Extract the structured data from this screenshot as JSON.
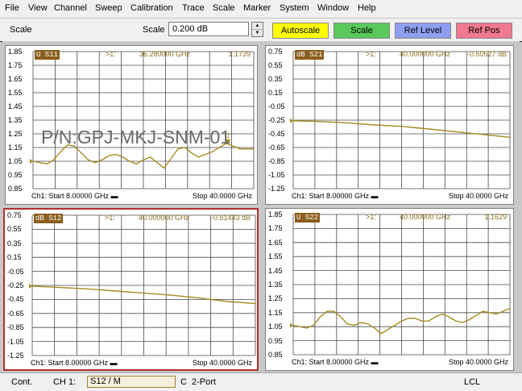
{
  "menu": [
    "File",
    "View",
    "Channel",
    "Sweep",
    "Calibration",
    "Trace",
    "Scale",
    "Marker",
    "System",
    "Window",
    "Help"
  ],
  "toolbar": {
    "title": "Scale",
    "scale_label": "Scale",
    "scale_value": "0.200 dB",
    "buttons": {
      "autoscale": "Autoscale",
      "scale": "Scale",
      "ref_level": "Ref Level",
      "ref_pos": "Ref Pos"
    },
    "colors": {
      "autoscale": "#ffff00",
      "scale": "#5ac85a",
      "ref_level": "#8f9ff0",
      "ref_pos": "#f07890"
    }
  },
  "watermark": "P/N:GPJ-MKJ-SNM-01",
  "trace_color": "#a68a1e",
  "panels": [
    {
      "id": "s11",
      "header": {
        "tag": "U S11",
        "marker": ">1:",
        "freq": "36.280000 GHz",
        "value": "1.1739"
      },
      "y_labels": [
        "1.85",
        "1.75",
        "1.65",
        "1.55",
        "1.45",
        "1.35",
        "1.25",
        "1.15",
        "1.05",
        "0.95",
        "0.85"
      ],
      "y_range": [
        0.85,
        1.85
      ],
      "footer": {
        "start": "Ch1: Start  8.00000 GHz",
        "stop": "Stop  40.0000 GHz"
      },
      "active": false,
      "marker_point": {
        "freq_ghz": 36.28,
        "value": 1.1739,
        "label": "1"
      },
      "trace": [
        [
          8,
          1.05
        ],
        [
          9,
          1.04
        ],
        [
          10,
          1.03
        ],
        [
          11,
          1.06
        ],
        [
          12,
          1.12
        ],
        [
          13,
          1.17
        ],
        [
          14,
          1.16
        ],
        [
          15,
          1.11
        ],
        [
          16,
          1.06
        ],
        [
          17,
          1.04
        ],
        [
          18,
          1.06
        ],
        [
          19,
          1.09
        ],
        [
          20,
          1.1
        ],
        [
          21,
          1.08
        ],
        [
          22,
          1.05
        ],
        [
          23,
          1.03
        ],
        [
          24,
          1.06
        ],
        [
          25,
          1.08
        ],
        [
          26,
          1.04
        ],
        [
          27,
          1.0
        ],
        [
          28,
          1.07
        ],
        [
          29,
          1.14
        ],
        [
          30,
          1.15
        ],
        [
          31,
          1.11
        ],
        [
          32,
          1.08
        ],
        [
          33,
          1.1
        ],
        [
          34,
          1.12
        ],
        [
          35,
          1.15
        ],
        [
          36,
          1.18
        ],
        [
          37,
          1.16
        ],
        [
          38,
          1.14
        ],
        [
          39,
          1.14
        ],
        [
          40,
          1.14
        ]
      ]
    },
    {
      "id": "s21",
      "header": {
        "tag": "dB S21",
        "marker": ">1:",
        "freq": "40.000000 GHz",
        "value": "-0.50527 dB"
      },
      "y_labels": [
        "0.75",
        "0.55",
        "0.35",
        "0.15",
        "-0.05",
        "-0.25",
        "-0.45",
        "-0.65",
        "-0.85",
        "-1.05",
        "-1.25"
      ],
      "y_range": [
        -1.25,
        0.75
      ],
      "footer": {
        "start": "Ch1: Start  8.00000 GHz",
        "stop": "Stop  40.0000 GHz"
      },
      "active": false,
      "trace": [
        [
          8,
          -0.26
        ],
        [
          12,
          -0.27
        ],
        [
          16,
          -0.29
        ],
        [
          20,
          -0.32
        ],
        [
          24,
          -0.34
        ],
        [
          28,
          -0.38
        ],
        [
          32,
          -0.42
        ],
        [
          36,
          -0.46
        ],
        [
          40,
          -0.5
        ]
      ]
    },
    {
      "id": "s12",
      "header": {
        "tag": "dB S12",
        "marker": ">1:",
        "freq": "40.000000 GHz",
        "value": "-0.51443 dB"
      },
      "y_labels": [
        "0.75",
        "0.55",
        "0.35",
        "0.15",
        "-0.05",
        "-0.25",
        "-0.45",
        "-0.65",
        "-0.85",
        "-1.05",
        "-1.25"
      ],
      "y_range": [
        -1.25,
        0.75
      ],
      "footer": {
        "start": "Ch1: Start  8.00000 GHz",
        "stop": "Stop  40.0000 GHz"
      },
      "active": true,
      "trace": [
        [
          8,
          -0.26
        ],
        [
          12,
          -0.28
        ],
        [
          16,
          -0.3
        ],
        [
          20,
          -0.33
        ],
        [
          24,
          -0.36
        ],
        [
          28,
          -0.39
        ],
        [
          32,
          -0.43
        ],
        [
          36,
          -0.48
        ],
        [
          40,
          -0.51
        ]
      ]
    },
    {
      "id": "s22",
      "header": {
        "tag": "U S22",
        "marker": ">1:",
        "freq": "40.000000 GHz",
        "value": "1.1629"
      },
      "y_labels": [
        "1.85",
        "1.75",
        "1.65",
        "1.55",
        "1.45",
        "1.35",
        "1.25",
        "1.15",
        "1.05",
        "0.95",
        "0.85"
      ],
      "y_range": [
        0.85,
        1.85
      ],
      "footer": {
        "start": "Ch1: Start  8.00000 GHz",
        "stop": "Stop  40.0000 GHz"
      },
      "active": false,
      "trace": [
        [
          8,
          1.06
        ],
        [
          9,
          1.05
        ],
        [
          10,
          1.04
        ],
        [
          11,
          1.06
        ],
        [
          12,
          1.12
        ],
        [
          13,
          1.16
        ],
        [
          14,
          1.16
        ],
        [
          15,
          1.12
        ],
        [
          16,
          1.07
        ],
        [
          17,
          1.06
        ],
        [
          18,
          1.08
        ],
        [
          19,
          1.07
        ],
        [
          20,
          1.04
        ],
        [
          21,
          1.0
        ],
        [
          22,
          1.03
        ],
        [
          23,
          1.06
        ],
        [
          24,
          1.09
        ],
        [
          25,
          1.11
        ],
        [
          26,
          1.11
        ],
        [
          27,
          1.09
        ],
        [
          28,
          1.09
        ],
        [
          29,
          1.12
        ],
        [
          30,
          1.14
        ],
        [
          31,
          1.12
        ],
        [
          32,
          1.09
        ],
        [
          33,
          1.08
        ],
        [
          34,
          1.1
        ],
        [
          35,
          1.13
        ],
        [
          36,
          1.16
        ],
        [
          37,
          1.15
        ],
        [
          38,
          1.14
        ],
        [
          39,
          1.16
        ],
        [
          40,
          1.18
        ]
      ]
    }
  ],
  "statusbar": {
    "mode": "Cont.",
    "channel": "CH 1:",
    "measurement": "S12 / M",
    "cal": "C",
    "ports": "2-Port",
    "ref": "LCL"
  }
}
